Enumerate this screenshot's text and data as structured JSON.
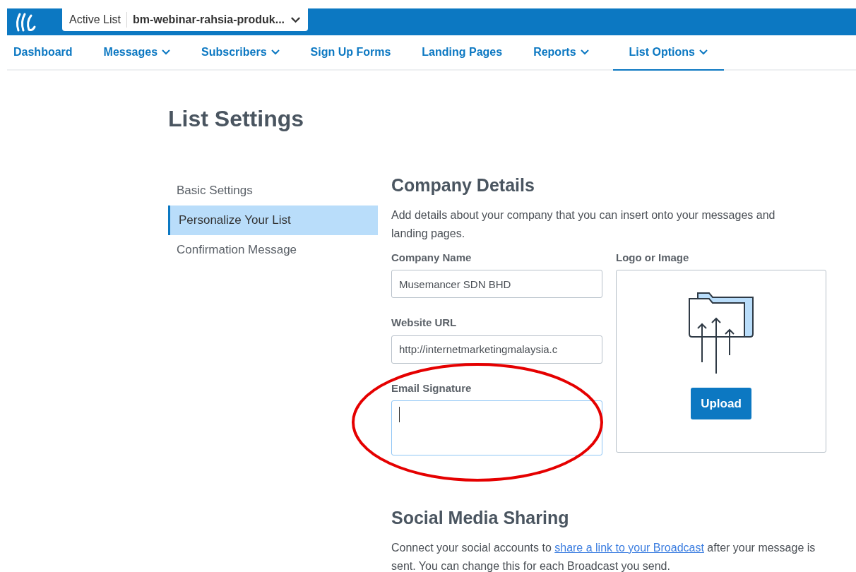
{
  "topbar": {
    "list_label": "Active List",
    "list_name": "bm-webinar-rahsia-produk..."
  },
  "nav": [
    {
      "label": "Dashboard",
      "dropdown": false,
      "selected": false
    },
    {
      "label": "Messages",
      "dropdown": true,
      "selected": false
    },
    {
      "label": "Subscribers",
      "dropdown": true,
      "selected": false
    },
    {
      "label": "Sign Up Forms",
      "dropdown": false,
      "selected": false
    },
    {
      "label": "Landing Pages",
      "dropdown": false,
      "selected": false
    },
    {
      "label": "Reports",
      "dropdown": true,
      "selected": false
    },
    {
      "label": "List Options",
      "dropdown": true,
      "selected": true
    }
  ],
  "page_title": "List Settings",
  "sidebar": {
    "items": [
      {
        "label": "Basic Settings",
        "selected": false
      },
      {
        "label": "Personalize Your List",
        "selected": true
      },
      {
        "label": "Confirmation Message",
        "selected": false
      }
    ]
  },
  "company_details": {
    "heading": "Company Details",
    "description": "Add details about your company that you can insert onto your messages and landing pages.",
    "fields": [
      {
        "label": "Company Name",
        "value": "Musemancer SDN BHD",
        "kind": "input"
      },
      {
        "label": "Website URL",
        "value": "http://internetmarketingmalaysia.c",
        "kind": "input"
      },
      {
        "label": "Email Signature",
        "kind": "textarea",
        "focused": true
      }
    ],
    "logo": {
      "label": "Logo or Image",
      "button": "Upload"
    }
  },
  "social": {
    "heading": "Social Media Sharing",
    "text_before": "Connect your social accounts to ",
    "link": "share a link to your Broadcast",
    "text_after": " after your message is sent. You can change this for each Broadcast you send."
  },
  "annotation": {
    "kind": "ellipse",
    "color": "#e50000"
  }
}
